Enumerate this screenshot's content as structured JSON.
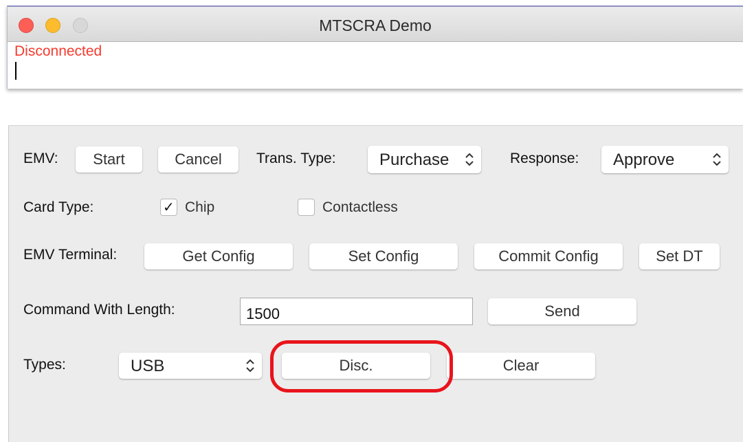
{
  "window": {
    "title": "MTSCRA Demo",
    "status": "Disconnected",
    "status_color": "#f43b2f"
  },
  "emv": {
    "label": "EMV:",
    "start_label": "Start",
    "cancel_label": "Cancel",
    "trans_type_label": "Trans. Type:",
    "trans_type_value": "Purchase",
    "response_label": "Response:",
    "response_value": "Approve"
  },
  "card_type": {
    "label": "Card Type:",
    "chip_label": "Chip",
    "chip_checked": true,
    "contactless_label": "Contactless",
    "contactless_checked": false
  },
  "emv_terminal": {
    "label": "EMV Terminal:",
    "get_config_label": "Get Config",
    "set_config_label": "Set Config",
    "commit_config_label": "Commit Config",
    "set_dt_label": "Set DT"
  },
  "command": {
    "label": "Command With Length:",
    "value": "1500",
    "send_label": "Send"
  },
  "types": {
    "label": "Types:",
    "value": "USB",
    "disc_label": "Disc.",
    "clear_label": "Clear"
  },
  "annotation": {
    "highlight_color": "#e8141c"
  }
}
